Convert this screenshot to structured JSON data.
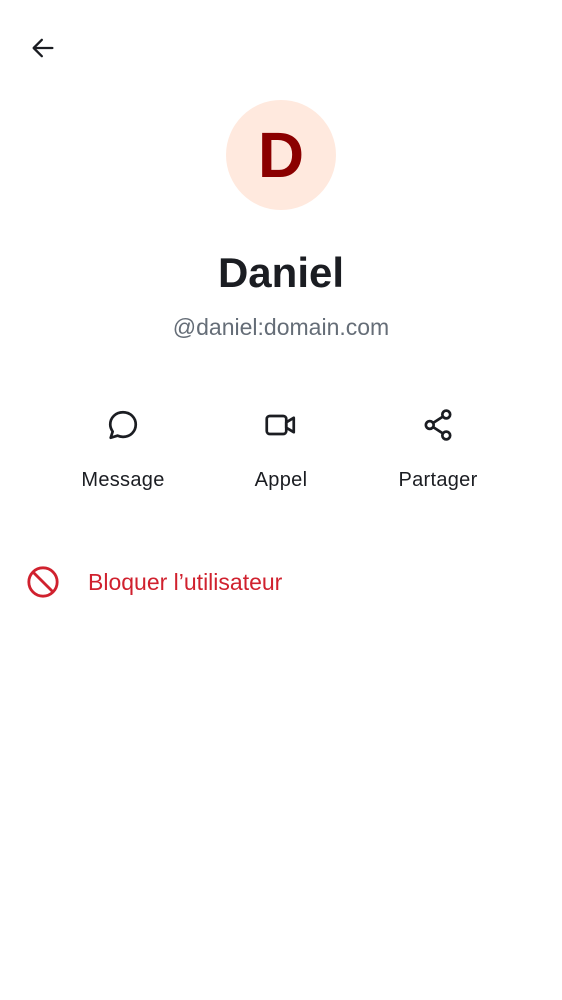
{
  "header": {
    "back_icon": "arrow-left-icon"
  },
  "profile": {
    "avatar_letter": "D",
    "avatar_bg": "#ffe9de",
    "avatar_fg": "#8b0000",
    "name": "Daniel",
    "user_id": "@daniel:domain.com"
  },
  "actions": [
    {
      "label": "Message",
      "icon": "chat-bubble-icon"
    },
    {
      "label": "Appel",
      "icon": "video-camera-icon"
    },
    {
      "label": "Partager",
      "icon": "share-icon"
    }
  ],
  "block": {
    "label": "Bloquer l’utilisateur",
    "icon": "block-icon",
    "color": "#d0212e"
  }
}
